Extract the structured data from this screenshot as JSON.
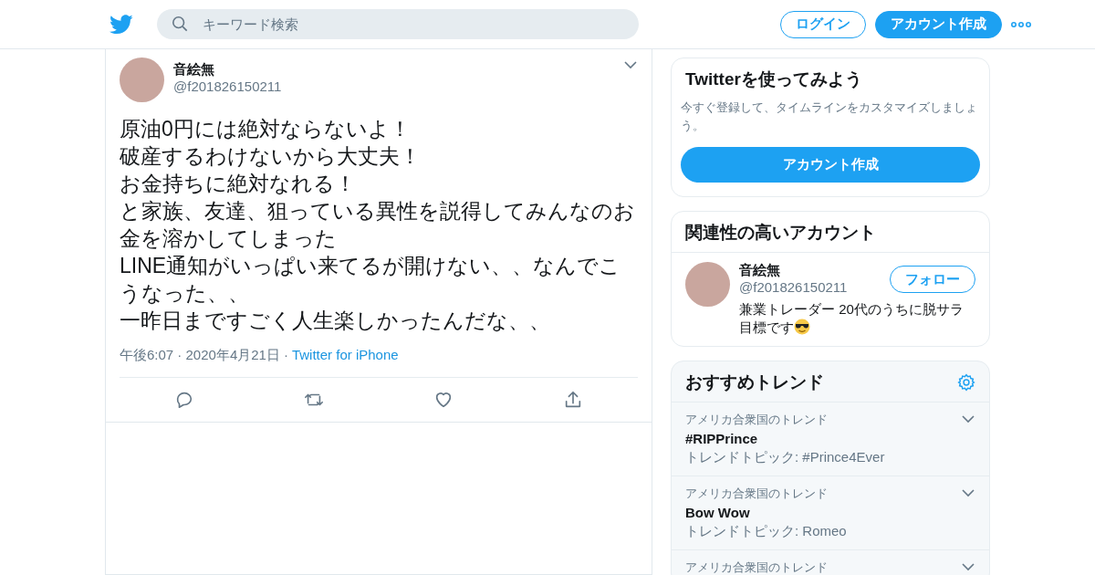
{
  "header": {
    "search": {
      "placeholder": "キーワード検索"
    },
    "login_button": "ログイン",
    "signup_button": "アカウント作成"
  },
  "tweet": {
    "name": "音絵無",
    "handle": "@f201826150211",
    "text_lines": [
      "原油0円には絶対ならないよ！",
      "破産するわけないから大丈夫！",
      "お金持ちに絶対なれる！",
      "と家族、友達、狙っている異性を説得してみんなのお金を溶かしてしまった",
      "LINE通知がいっぱい来てるが開けない、、なんでこうなった、、",
      "一昨日まですごく人生楽しかったんだな、、"
    ],
    "time": "午後6:07 · 2020年4月21日",
    "separator": "·",
    "source": "Twitter for iPhone"
  },
  "signup_card": {
    "title": "Twitterを使ってみよう",
    "description": "今すぐ登録して、タイムラインをカスタマイズしましょう。",
    "button": "アカウント作成"
  },
  "related_card": {
    "title": "関連性の高いアカウント",
    "accounts": [
      {
        "name": "音絵無",
        "handle": "@f201826150211",
        "follow_button": "フォロー",
        "bio_lines": [
          "兼業トレーダー 20代のうちに脱サラ",
          "目標です"
        ]
      }
    ]
  },
  "trends_card": {
    "title": "おすすめトレンド",
    "trends": [
      {
        "context": "アメリカ合衆国のトレンド",
        "name": "#RIPPrince",
        "topic": "トレンドトピック: #Prince4Ever"
      },
      {
        "context": "アメリカ合衆国のトレンド",
        "name": "Bow Wow",
        "topic": "トレンドトピック: Romeo"
      },
      {
        "context": "アメリカ合衆国のトレンド"
      }
    ]
  }
}
